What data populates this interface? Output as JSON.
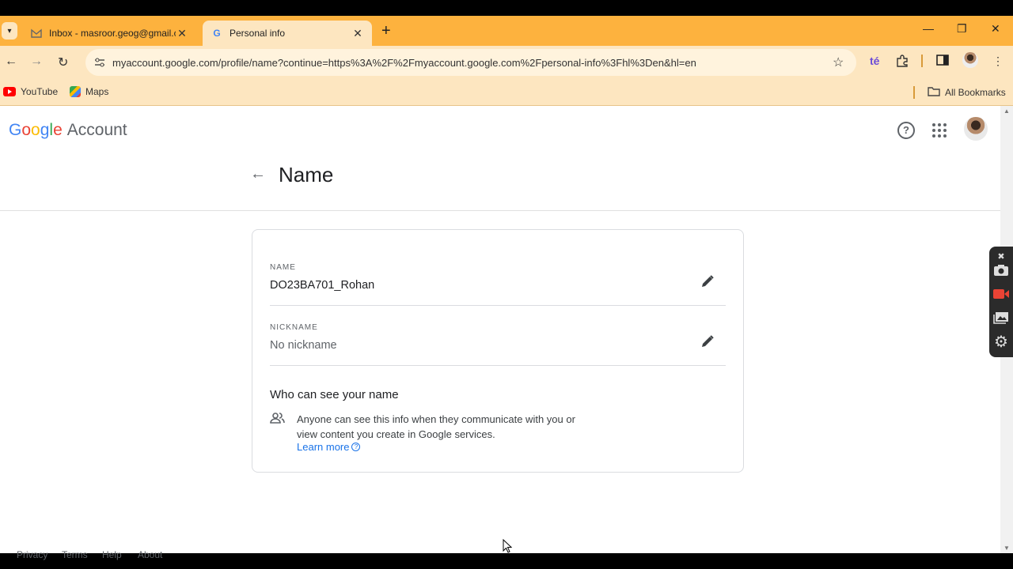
{
  "browser": {
    "tabs": [
      {
        "label": "Inbox - masroor.geog@gmail.c",
        "favicon": "gmail-icon",
        "active": false
      },
      {
        "label": "Personal info",
        "favicon": "google-g-icon",
        "active": true
      }
    ],
    "url": "myaccount.google.com/profile/name?continue=https%3A%2F%2Fmyaccount.google.com%2Fpersonal-info%3Fhl%3Den&hl=en",
    "extension_label": "té",
    "bookmarks": [
      {
        "label": "YouTube",
        "icon": "youtube-icon"
      },
      {
        "label": "Maps",
        "icon": "maps-icon"
      }
    ],
    "all_bookmarks": "All Bookmarks"
  },
  "header": {
    "logo_google": [
      "G",
      "o",
      "o",
      "g",
      "l",
      "e"
    ],
    "logo_account": "Account"
  },
  "page": {
    "title": "Name",
    "fields": [
      {
        "label": "NAME",
        "value": "DO23BA701_Rohan"
      },
      {
        "label": "NICKNAME",
        "value": "No nickname"
      }
    ],
    "visibility": {
      "title": "Who can see your name",
      "text": "Anyone can see this info when they communicate with you or view content you create in Google services.",
      "learn_more": "Learn more"
    }
  },
  "footer": {
    "links": [
      "Privacy",
      "Terms",
      "Help",
      "About"
    ]
  },
  "colors": {
    "tabstrip": "#fdb23e",
    "toolbar": "#fde6c0",
    "link": "#1a73e8"
  }
}
